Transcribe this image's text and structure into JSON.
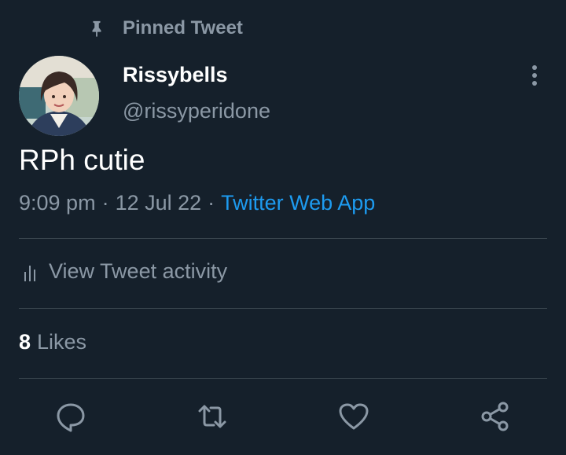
{
  "pinned": {
    "label": "Pinned Tweet",
    "icon": "pin-icon"
  },
  "author": {
    "name": "Rissybells",
    "handle": "@rissyperidone",
    "avatar": "profile-avatar"
  },
  "tweet": {
    "text": "RPh cutie",
    "time": "9:09 pm",
    "date": "12 Jul 22",
    "separator": "·",
    "source": "Twitter Web App"
  },
  "activity": {
    "label": "View Tweet activity",
    "icon": "bar-chart-icon"
  },
  "likes": {
    "count": "8",
    "label": "Likes"
  },
  "actions": [
    {
      "icon": "reply-icon"
    },
    {
      "icon": "retweet-icon"
    },
    {
      "icon": "like-icon"
    },
    {
      "icon": "share-icon"
    }
  ],
  "colors": {
    "background": "#15202b",
    "secondary_text": "#8b98a5",
    "link": "#1d9bf0",
    "divider": "#38444d"
  }
}
